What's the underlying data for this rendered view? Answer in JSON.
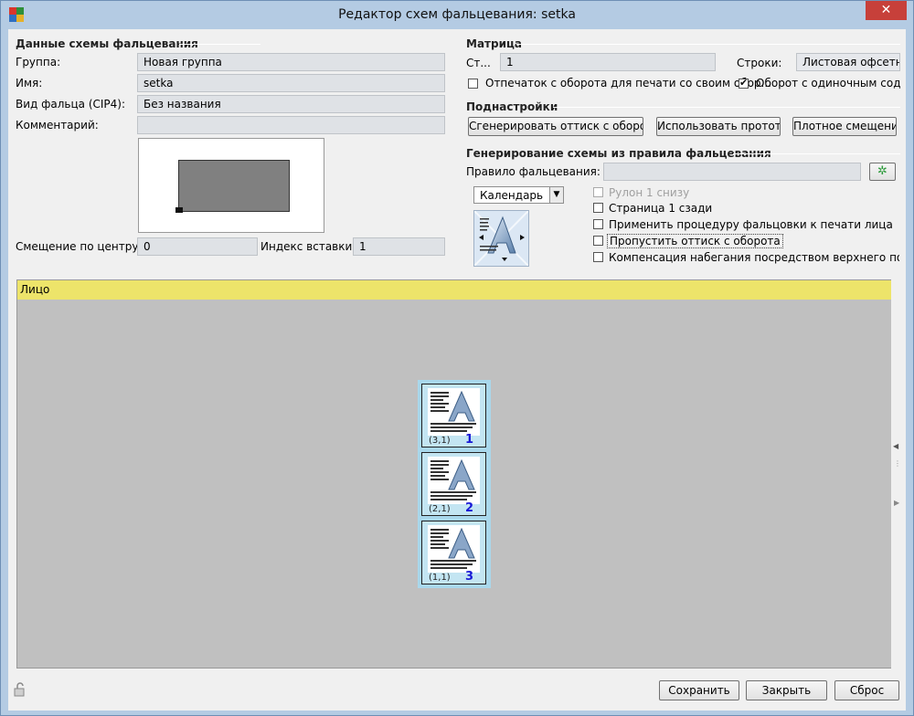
{
  "window": {
    "title": "Редактор схем фальцевания: setka",
    "close": "✕"
  },
  "scheme": {
    "header": "Данные схемы фальцевания",
    "group_label": "Группа:",
    "group_value": "Новая группа",
    "name_label": "Имя:",
    "name_value": "setka",
    "fold_label": "Вид фальца (CIP4):",
    "fold_value": "Без названия",
    "comment_label": "Комментарий:",
    "comment_value": "",
    "center_offset_label": "Смещение по центру:",
    "center_offset_value": "0",
    "insert_index_label": "Индекс вставки:",
    "insert_index_value": "1"
  },
  "matrix": {
    "header": "Матрица",
    "col_label": "Ст...",
    "col_value": "1",
    "rows_label": "Строки:",
    "rows_value": "Листовая офсетна",
    "cb_backside_label": "Отпечаток с оборота для печати со своим обор...",
    "cb_backside_checked": false,
    "cb_single_label": "Оборот с одиночным содер",
    "cb_single_checked": true
  },
  "subsettings": {
    "header": "Поднастройки",
    "btn_generate": "Сгенерировать оттиск с оборота",
    "btn_prototype": "Использовать прототип",
    "btn_tight": "Плотное смещение"
  },
  "generate": {
    "header": "Генерирование схемы из правила фальцевания",
    "rule_label": "Правило фальцевания:",
    "rule_value": "",
    "rule_button_icon": "gear-sparkle-icon",
    "calendar_value": "Календарь",
    "options": [
      {
        "label": "Рулон 1 снизу",
        "checked": false,
        "disabled": true
      },
      {
        "label": "Страница 1 сзади",
        "checked": false,
        "disabled": false
      },
      {
        "label": "Применить процедуру фальцовки к печати лица",
        "checked": false,
        "disabled": false
      },
      {
        "label": "Пропустить оттиск с оборота",
        "checked": false,
        "disabled": false
      },
      {
        "label": "Компенсация набегания посредством верхнего поля, пр",
        "checked": false,
        "disabled": false
      }
    ]
  },
  "face": {
    "header": "Лицо",
    "sheets": [
      {
        "coord": "(3,1)",
        "num": "1"
      },
      {
        "coord": "(2,1)",
        "num": "2"
      },
      {
        "coord": "(1,1)",
        "num": "3"
      }
    ]
  },
  "footer": {
    "save": "Сохранить",
    "close": "Закрыть",
    "reset": "Сброс"
  },
  "colors": {
    "face_header": "#ede46a",
    "sheet_bg": "#a9d8ec",
    "page_number": "#1a1ad6",
    "close_button": "#c7403a"
  }
}
